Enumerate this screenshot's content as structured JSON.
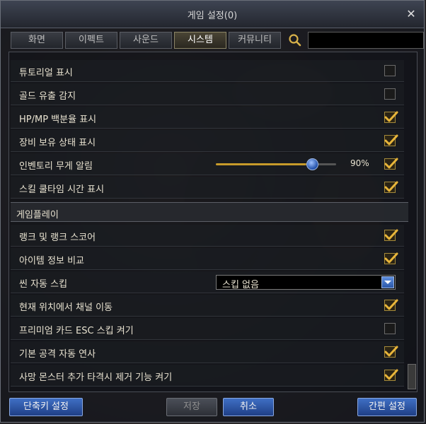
{
  "window": {
    "title": "게임 설정(0)"
  },
  "tabs": [
    {
      "label": "화면"
    },
    {
      "label": "이펙트"
    },
    {
      "label": "사운드"
    },
    {
      "label": "시스템",
      "active": true
    },
    {
      "label": "커뮤니티"
    }
  ],
  "search": {
    "value": "",
    "placeholder": ""
  },
  "settings_top": [
    {
      "label": "튜토리얼 표시",
      "checked": false
    },
    {
      "label": "골드 유출 감지",
      "checked": false
    },
    {
      "label": "HP/MP 백분율 표시",
      "checked": true
    },
    {
      "label": "장비 보유 상태 표시",
      "checked": true
    },
    {
      "label": "인벤토리 무게 알림",
      "checked": true,
      "slider_value": "90%",
      "slider_fraction": 0.75
    },
    {
      "label": "스킬 쿨타임 시간 표시",
      "checked": true
    }
  ],
  "section": {
    "title": "게임플레이"
  },
  "settings_gameplay": [
    {
      "label": "랭크 및 랭크 스코어",
      "checked": true
    },
    {
      "label": "아이템 정보 비교",
      "checked": true
    },
    {
      "label": "씬 자동 스킵",
      "dropdown_value": "스킵 없음"
    },
    {
      "label": "현재 위치에서 채널 이동",
      "checked": true
    },
    {
      "label": "프리미엄 카드 ESC 스킵 켜기",
      "checked": false
    },
    {
      "label": "기본 공격 자동 연사",
      "checked": true
    },
    {
      "label": "사망 몬스터 추가 타격시 제거 기능 켜기",
      "checked": true
    }
  ],
  "buttons": {
    "hotkey": "단축키 설정",
    "save": "저장",
    "cancel": "취소",
    "simple": "간편 설정"
  },
  "colors": {
    "accent": "#c79b2a",
    "button_blue": "#2f5fb4"
  }
}
